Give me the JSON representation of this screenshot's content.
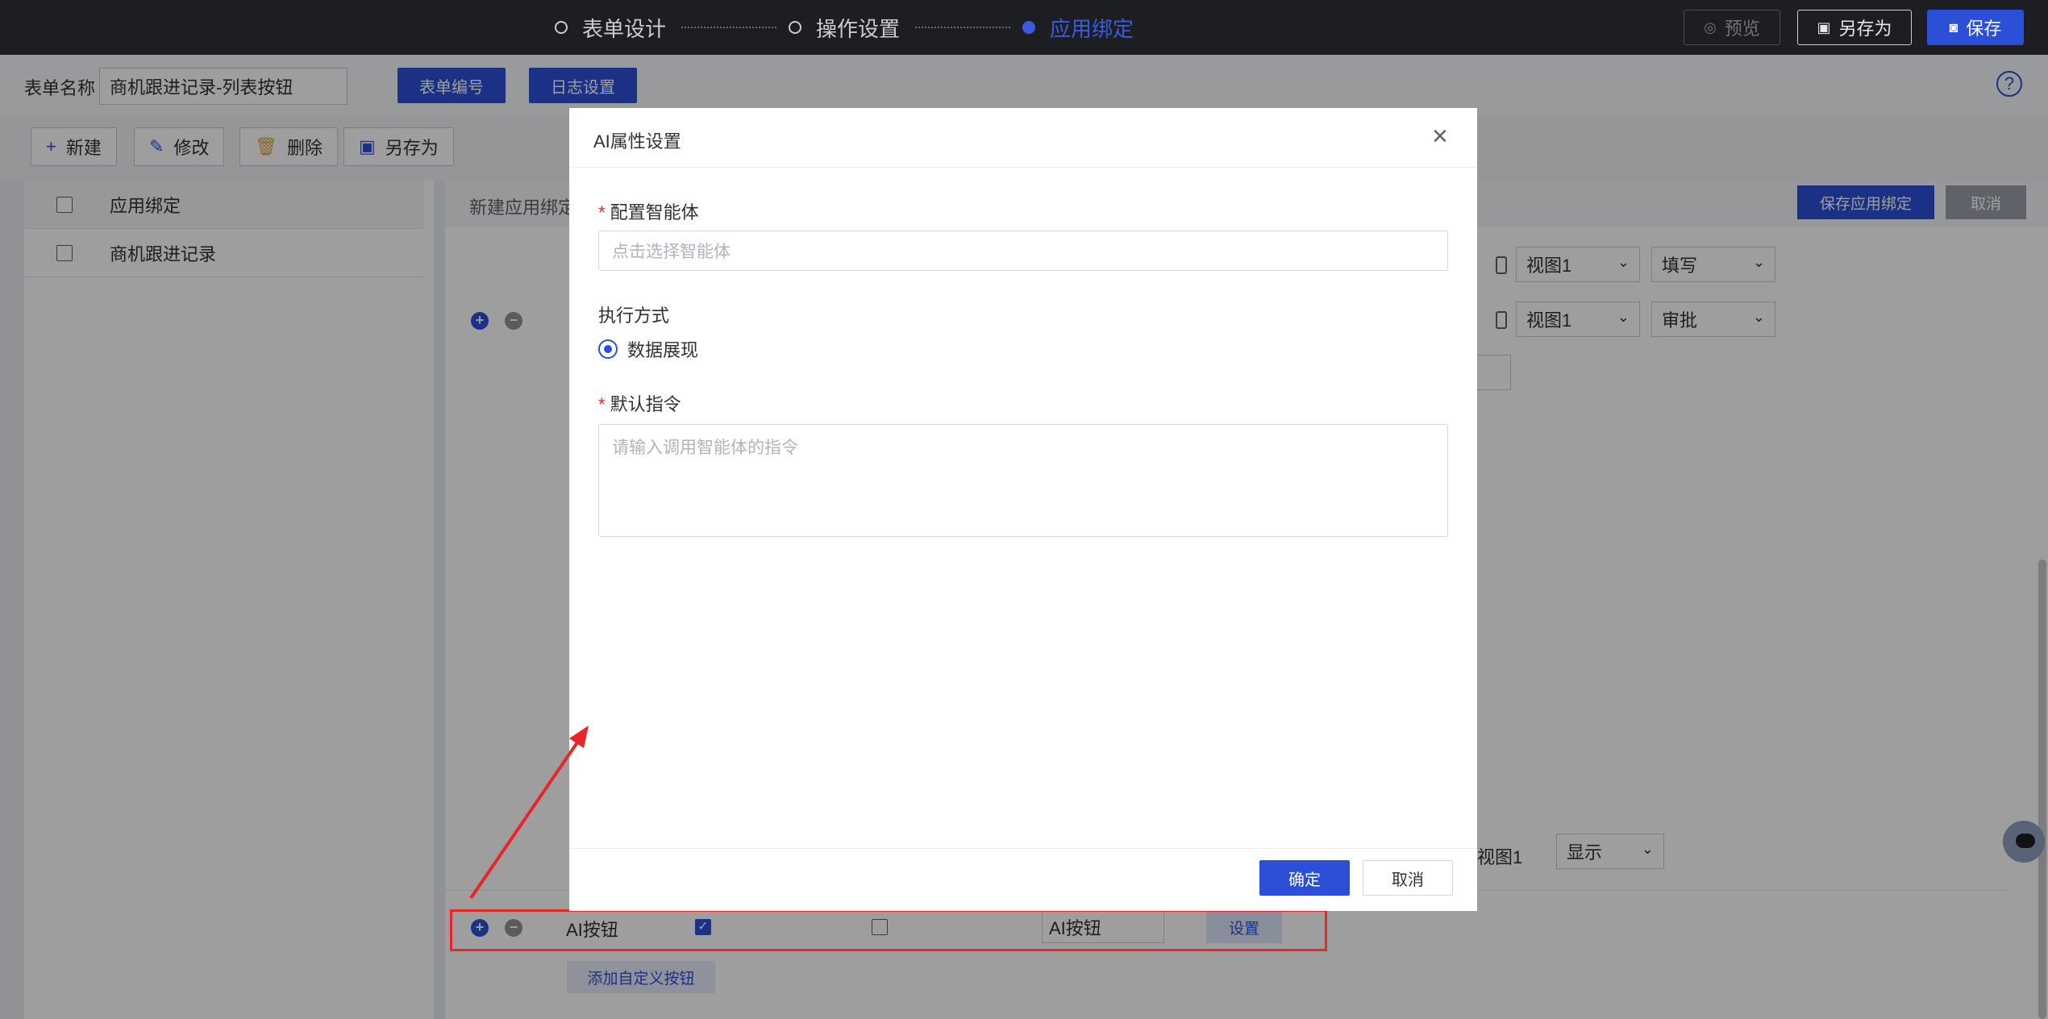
{
  "topbar": {
    "steps": [
      {
        "label": "表单设计"
      },
      {
        "label": "操作设置"
      },
      {
        "label": "应用绑定"
      }
    ],
    "preview_label": "预览",
    "saveas_label": "另存为",
    "save_label": "保存"
  },
  "form": {
    "name_label": "表单名称",
    "name_value": "商机跟进记录-列表按钮",
    "code_button": "表单编号",
    "log_button": "日志设置"
  },
  "toolbar": {
    "new_label": "新建",
    "edit_label": "修改",
    "delete_label": "删除",
    "saveas_label": "另存为"
  },
  "left_list": {
    "header": "应用绑定",
    "items": [
      "商机跟进记录"
    ]
  },
  "right_panel": {
    "title": "新建应用绑定",
    "save_bind_label": "保存应用绑定",
    "cancel_label": "取消",
    "row1": {
      "view": "视图1",
      "mode": "填写"
    },
    "row2": {
      "view": "视图1",
      "mode": "审批"
    },
    "row_last": {
      "view": "视图1",
      "display": "显示"
    },
    "ai_row": {
      "name": "AI按钮",
      "alias": "AI按钮",
      "setting_label": "设置"
    },
    "add_custom_label": "添加自定义按钮"
  },
  "modal": {
    "title": "AI属性设置",
    "agent_label": "配置智能体",
    "agent_placeholder": "点击选择智能体",
    "exec_label": "执行方式",
    "exec_option": "数据展现",
    "cmd_label": "默认指令",
    "cmd_placeholder": "请输入调用智能体的指令",
    "ok_label": "确定",
    "cancel_label": "取消"
  },
  "colors": {
    "accent": "#2c4fd8",
    "annotation": "#e8262a"
  }
}
